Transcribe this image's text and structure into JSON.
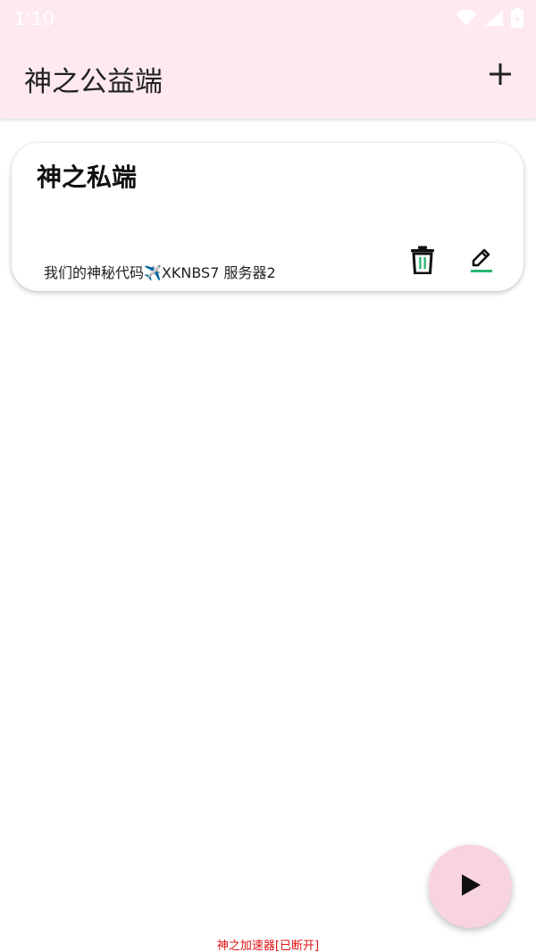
{
  "status_bar": {
    "time": "1:10",
    "icons": [
      "wifi-icon",
      "signal-icon",
      "battery-icon"
    ]
  },
  "app_bar": {
    "title": "神之公益端",
    "add_icon": "plus-icon"
  },
  "servers": [
    {
      "title": "神之私端",
      "subtitle": "我们的神秘代码✈️XKNBS7 服务器2",
      "delete_icon": "trash-icon",
      "edit_icon": "pencil-icon"
    }
  ],
  "fab": {
    "icon": "play-icon"
  },
  "connection_status": "神之加速器[已断开]",
  "colors": {
    "app_bar_bg": "#fde9ef",
    "fab_bg": "#f8d3e0",
    "status_text": "#e01010",
    "edit_underline": "#2bb673"
  }
}
